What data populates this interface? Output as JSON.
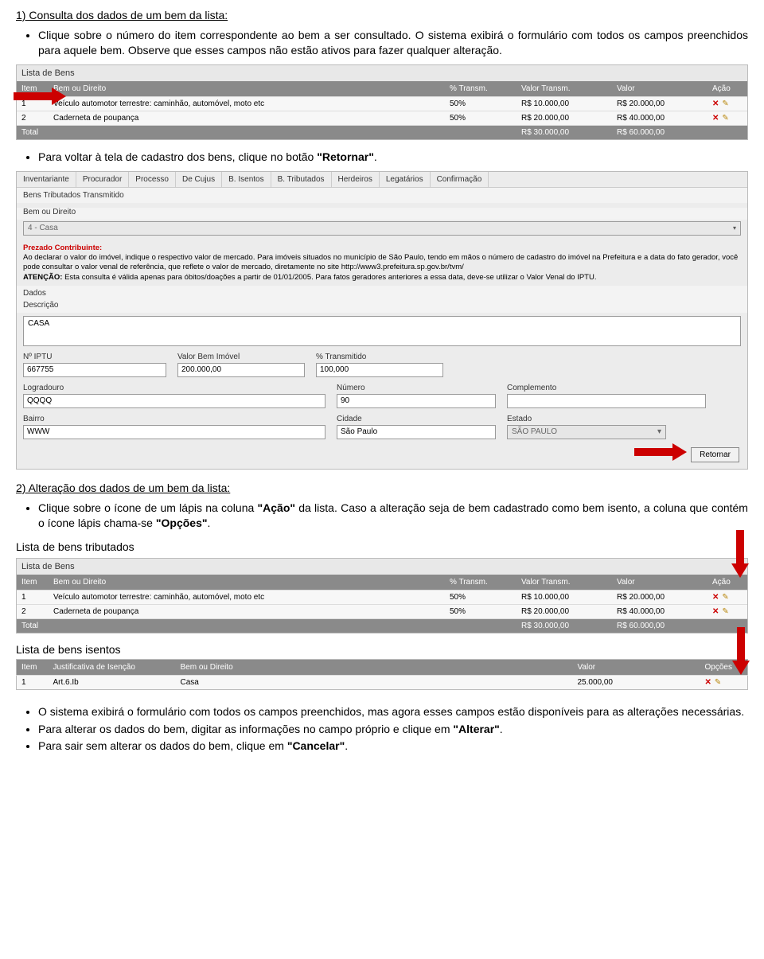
{
  "section1": {
    "title": "1) Consulta dos dados de um bem da lista:",
    "b1": "Clique sobre o número do item correspondente ao bem a ser consultado. O sistema exibirá o formulário com todos os campos preenchidos para aquele bem. Observe que esses campos não estão ativos para fazer qualquer alteração.",
    "b2_pre": "Para voltar à tela de cadastro dos bens, clique no botão ",
    "b2_bold": "\"Retornar\"",
    "b2_post": "."
  },
  "bens_table": {
    "title": "Lista de Bens",
    "headers": {
      "item": "Item",
      "bem": "Bem ou Direito",
      "pct": "% Transm.",
      "vtrans": "Valor Transm.",
      "valor": "Valor",
      "acao": "Ação"
    },
    "rows": [
      {
        "item": "1",
        "bem": "Veículo automotor terrestre: caminhão, automóvel, moto etc",
        "pct": "50%",
        "vtrans": "R$ 10.000,00",
        "valor": "R$ 20.000,00"
      },
      {
        "item": "2",
        "bem": "Caderneta de poupança",
        "pct": "50%",
        "vtrans": "R$ 20.000,00",
        "valor": "R$ 40.000,00"
      }
    ],
    "total": {
      "label": "Total",
      "vtrans": "R$ 30.000,00",
      "valor": "R$ 60.000,00"
    }
  },
  "form": {
    "tabs": [
      "Inventariante",
      "Procurador",
      "Processo",
      "De Cujus",
      "B. Isentos",
      "B. Tributados",
      "Herdeiros",
      "Legatários",
      "Confirmação"
    ],
    "sec1": "Bens Tributados Transmitido",
    "lbl_bem": "Bem ou Direito",
    "dd_bem": "4 - Casa",
    "notice_head": "Prezado Contribuinte:",
    "notice_body1": "Ao declarar o valor do imóvel, indique o respectivo valor de mercado. Para imóveis situados no município de São Paulo, tendo em mãos o número de cadastro do imóvel na Prefeitura e a data do fato gerador, você pode consultar o valor venal de referência, que reflete o valor de mercado, diretamente no site http://www3.prefeitura.sp.gov.br/tvm/",
    "notice_body2_b": "ATENÇÃO:",
    "notice_body2": " Esta consulta é válida apenas para óbitos/doações a partir de 01/01/2005. Para fatos geradores anteriores a essa data, deve-se utilizar o Valor Venal do IPTU.",
    "lbl_dados": "Dados",
    "lbl_desc": "Descrição",
    "val_desc": "CASA",
    "lbl_iptu": "Nº IPTU",
    "val_iptu": "667755",
    "lbl_valbem": "Valor Bem Imóvel",
    "val_valbem": "200.000,00",
    "lbl_pct": "% Transmitido",
    "val_pct": "100,000",
    "lbl_log": "Logradouro",
    "val_log": "QQQQ",
    "lbl_num": "Número",
    "val_num": "90",
    "lbl_comp": "Complemento",
    "val_comp": "",
    "lbl_bairro": "Bairro",
    "val_bairro": "WWW",
    "lbl_cidade": "Cidade",
    "val_cidade": "São Paulo",
    "lbl_estado": "Estado",
    "val_estado": "SÃO PAULO",
    "btn_ret": "Retornar"
  },
  "section2": {
    "title": "2) Alteração dos dados de um bem da lista:",
    "b1_pre": "Clique sobre o ícone de um lápis na coluna ",
    "b1_bold1": "\"Ação\"",
    "b1_mid": " da lista. Caso a alteração seja de bem cadastrado como bem isento, a coluna que contém o ícone lápis chama-se ",
    "b1_bold2": "\"Opções\"",
    "b1_post": "."
  },
  "head_trib": "Lista de bens tributados",
  "head_isen": "Lista de bens isentos",
  "isentos_table": {
    "headers": {
      "item": "Item",
      "just": "Justificativa de Isenção",
      "bem": "Bem ou Direito",
      "valor": "Valor",
      "opc": "Opções"
    },
    "row": {
      "item": "1",
      "just": "Art.6.Ib",
      "bem": "Casa",
      "valor": "25.000,00"
    }
  },
  "section3": {
    "b1": "O sistema exibirá o formulário com todos os campos preenchidos, mas agora esses campos estão disponíveis para as alterações necessárias.",
    "b2_pre": "Para alterar os dados do bem, digitar as informações no campo próprio e clique em ",
    "b2_bold": "\"Alterar\"",
    "b2_post": ".",
    "b3_pre": "Para sair sem alterar os dados do bem, clique em ",
    "b3_bold": "\"Cancelar\"",
    "b3_post": "."
  }
}
